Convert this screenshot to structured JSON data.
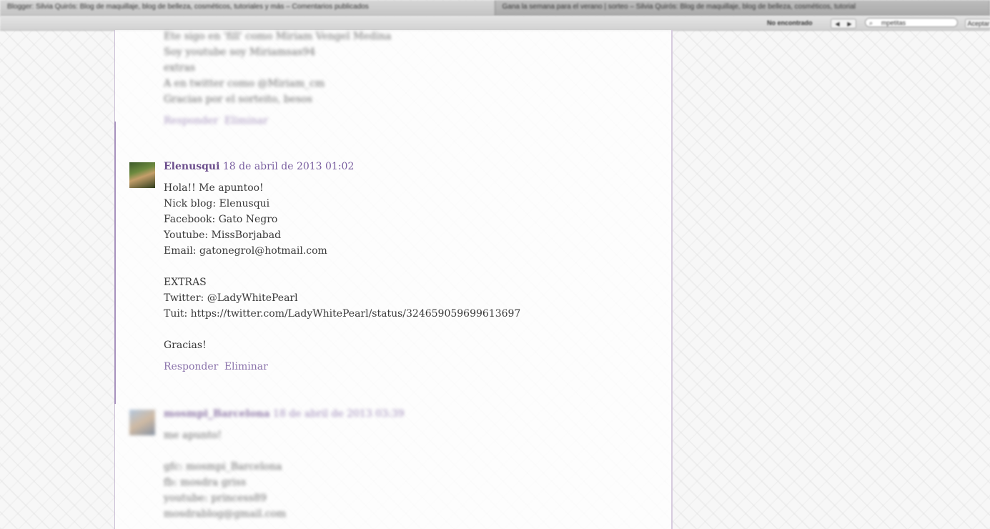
{
  "browser": {
    "tabs": [
      {
        "title": "Blogger: Silvia Quirós: Blog de maquillaje, blog de belleza, cosméticos, tutoriales y más – Comentarios publicados",
        "active": true
      },
      {
        "title": "Gana la semana para el verano | sorteo – Silvia Quirós: Blog de maquillaje, blog de belleza, cosméticos, tutorial",
        "active": false
      }
    ],
    "findbar": {
      "status": "No encontrado",
      "prev": "◀",
      "next": "▶",
      "query": "mpetitas",
      "search_icon": "search-icon",
      "done_label": "Aceptar"
    }
  },
  "comments": [
    {
      "lines": [
        "Ete sigo en 'fill' como Miriam Vengel Medina",
        "Soy youtube soy Miriamsas94",
        "extras",
        "A en twitter como @Miriam_cm",
        "Gracias por el sorteito, besos"
      ],
      "actions": [
        "Responder",
        "Eliminar"
      ]
    },
    {
      "author": "Elenusqui",
      "date": "18 de abril de 2013 01:02",
      "lines": [
        "Hola!! Me apuntoo!",
        "Nick blog: Elenusqui",
        "Facebook: Gato Negro",
        "Youtube: MissBorjabad",
        "Email: gatonegrol@hotmail.com",
        "",
        "EXTRAS",
        "Twitter: @LadyWhitePearl",
        "Tuit: https://twitter.com/LadyWhitePearl/status/324659059699613697",
        "",
        "Gracias!"
      ],
      "actions": [
        "Responder",
        "Eliminar"
      ]
    },
    {
      "author": "mosmpi_Barcelona",
      "date": "18 de abril de 2013 03:39",
      "lines": [
        "me apunto!",
        "",
        "gfc: mosmpi_Barcelona",
        "fb: mosdra griss",
        "youtube: princess89",
        "mosdrablog@gmail.com"
      ]
    }
  ]
}
